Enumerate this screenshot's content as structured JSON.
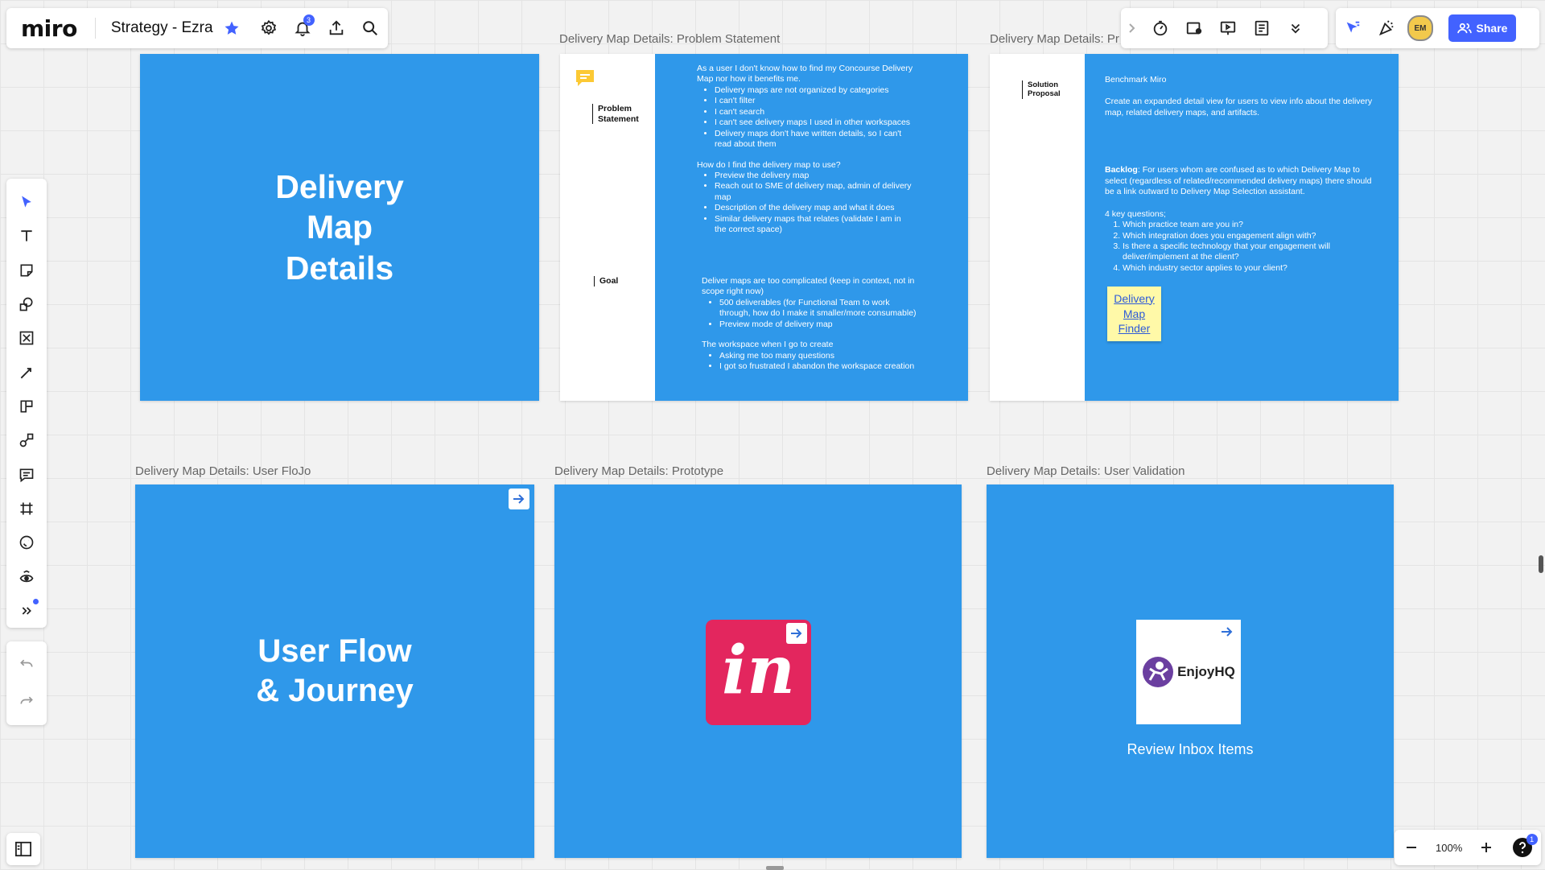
{
  "app": {
    "logo": "miro",
    "board_title": "Strategy - Ezra",
    "notifications_count": "3",
    "share_label": "Share",
    "avatar_initials": "EM",
    "help_badge": "1",
    "zoom_level": "100%"
  },
  "frames": {
    "delivery_details": {
      "title_lines": [
        "Delivery",
        "Map",
        "Details"
      ]
    },
    "problem_statement": {
      "label": "Delivery Map Details: Problem Statement",
      "section_problem": "Problem Statement",
      "section_goal": "Goal",
      "intro": "As a user I don't know how to find my Concourse Delivery Map nor how it benefits me.",
      "problems": [
        "Delivery maps are not organized by categories",
        "I can't filter",
        "I can't search",
        "I can't see delivery maps I used in other workspaces",
        "Delivery maps don't have written details, so I can't read about them"
      ],
      "find_question": "How do I find the delivery map to use?",
      "find_items": [
        "Preview the delivery map",
        "Reach out to SME of delivery map, admin of delivery map",
        "Description of the delivery map and what it does",
        "Similar delivery maps that relates (validate I am in the correct space)"
      ],
      "goal_intro": "Deliver maps are too complicated (keep in context, not in scope right now)",
      "goal_items": [
        "500 deliverables (for Functional Team to work through, how do I make it smaller/more consumable)",
        "Preview mode of delivery map"
      ],
      "workspace_intro": "The workspace when I go to create",
      "workspace_items": [
        "Asking me too many questions",
        "I got so frustrated I abandon the workspace creation"
      ]
    },
    "proposal": {
      "label": "Delivery Map Details: Pr",
      "section_label": "Solution Proposal",
      "benchmark": "Benchmark Miro",
      "description": "Create an expanded detail view for users to view info about the delivery map, related delivery maps, and artifacts.",
      "backlog_label": "Backlog",
      "backlog_text": ": For users whom are confused as to which Delivery Map to select (regardless of related/recommended delivery maps) there should be a link outward to Delivery Map Selection assistant.",
      "questions_intro": "4 key questions;",
      "questions": [
        "Which practice team are you in?",
        "Which integration does you engagement align with?",
        "Is there a specific technology that your engagement will deliver/implement at the client?",
        "Which industry sector applies to your client?"
      ],
      "sticky_lines": [
        "Delivery",
        "Map",
        "Finder"
      ]
    },
    "user_flow": {
      "label": "Delivery Map Details: User FloJo",
      "title_lines": [
        "User Flow",
        "& Journey"
      ]
    },
    "prototype": {
      "label": "Delivery Map Details: Prototype",
      "app_logo_text": "in"
    },
    "validation": {
      "label": "Delivery Map Details: User Validation",
      "card_text": "EnjoyHQ",
      "caption": "Review Inbox Items"
    }
  },
  "colors": {
    "frame_blue": "#2f98ea",
    "accent": "#4262ff",
    "invision": "#e3265e",
    "sticky": "#fff9a8"
  }
}
